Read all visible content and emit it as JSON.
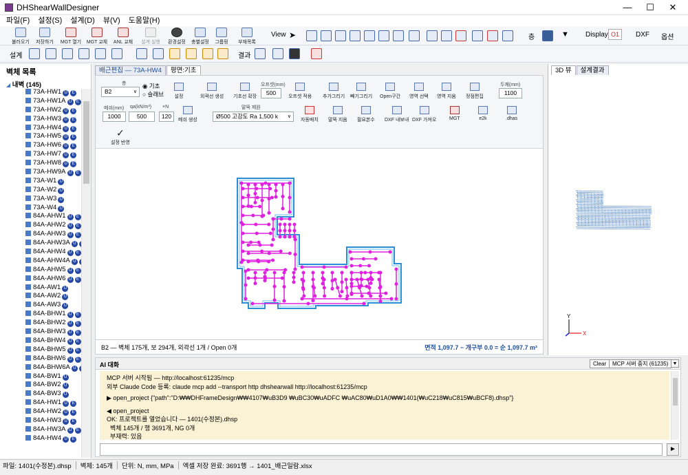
{
  "window": {
    "title": "DHShearWallDesigner",
    "minimize": "—",
    "maximize": "☐",
    "close": "✕"
  },
  "menu": [
    "파일(F)",
    "설정(S)",
    "설계(D)",
    "뷰(V)",
    "도움말(H)"
  ],
  "toolbar1": {
    "buttons": [
      "불러오기",
      "저장하기",
      "MGT 열기",
      "MGT 교체",
      "ANL 교체",
      "설계 실행",
      "환경설정",
      "충별설정",
      "그룹핑",
      "부재목록"
    ],
    "right_labels": {
      "view": "View",
      "layer": "층",
      "display": "Display",
      "display_value": "O1",
      "dxf": "DXF",
      "options": "옵션"
    }
  },
  "toolbar2": {
    "design": "설계",
    "result": "결과"
  },
  "left_panel": {
    "title": "벽체 목록",
    "root": "내벽 (145)",
    "items": [
      {
        "name": "73A-HW1",
        "badges": [
          "U",
          "E"
        ]
      },
      {
        "name": "73A-HW1A",
        "badges": [
          "U",
          "E"
        ]
      },
      {
        "name": "73A-HW2",
        "badges": [
          "U",
          "E"
        ]
      },
      {
        "name": "73A-HW3",
        "badges": [
          "U",
          "E"
        ]
      },
      {
        "name": "73A-HW4",
        "badges": [
          "U",
          "E"
        ]
      },
      {
        "name": "73A-HW5",
        "badges": [
          "U",
          "E"
        ]
      },
      {
        "name": "73A-HW6",
        "badges": [
          "U",
          "E"
        ]
      },
      {
        "name": "73A-HW7",
        "badges": [
          "U",
          "E"
        ]
      },
      {
        "name": "73A-HW8",
        "badges": [
          "U",
          "E"
        ]
      },
      {
        "name": "73A-HW9A",
        "badges": [
          "U",
          "E"
        ]
      },
      {
        "name": "73A-W1",
        "badges": [
          "U"
        ]
      },
      {
        "name": "73A-W2",
        "badges": [
          "U"
        ]
      },
      {
        "name": "73A-W3",
        "badges": [
          "U"
        ]
      },
      {
        "name": "73A-W4",
        "badges": [
          "U"
        ]
      },
      {
        "name": "84A-AHW1",
        "badges": [
          "U",
          "E"
        ]
      },
      {
        "name": "84A-AHW2",
        "badges": [
          "U",
          "E"
        ]
      },
      {
        "name": "84A-AHW3",
        "badges": [
          "U",
          "E"
        ]
      },
      {
        "name": "84A-AHW3A",
        "badges": [
          "U",
          "E"
        ]
      },
      {
        "name": "84A-AHW4",
        "badges": [
          "U",
          "E"
        ]
      },
      {
        "name": "84A-AHW4A",
        "badges": [
          "U",
          "E"
        ]
      },
      {
        "name": "84A-AHW5",
        "badges": [
          "U",
          "E"
        ]
      },
      {
        "name": "84A-AHW6",
        "badges": [
          "U",
          "E"
        ]
      },
      {
        "name": "84A-AW1",
        "badges": [
          "U"
        ]
      },
      {
        "name": "84A-AW2",
        "badges": [
          "U"
        ]
      },
      {
        "name": "84A-AW3",
        "badges": [
          "U"
        ]
      },
      {
        "name": "84A-BHW1",
        "badges": [
          "U",
          "E"
        ]
      },
      {
        "name": "84A-BHW2",
        "badges": [
          "U",
          "E"
        ]
      },
      {
        "name": "84A-BHW3",
        "badges": [
          "U",
          "E"
        ]
      },
      {
        "name": "84A-BHW4",
        "badges": [
          "U",
          "E"
        ]
      },
      {
        "name": "84A-BHW5",
        "badges": [
          "U",
          "E"
        ]
      },
      {
        "name": "84A-BHW6",
        "badges": [
          "U",
          "E"
        ]
      },
      {
        "name": "84A-BHW6A",
        "badges": [
          "U",
          "E"
        ]
      },
      {
        "name": "84A-BW1",
        "badges": [
          "U"
        ]
      },
      {
        "name": "84A-BW2",
        "badges": [
          "U"
        ]
      },
      {
        "name": "84A-BW3",
        "badges": [
          "U"
        ]
      },
      {
        "name": "84A-HW1",
        "badges": [
          "U",
          "E"
        ]
      },
      {
        "name": "84A-HW2",
        "badges": [
          "U",
          "E"
        ]
      },
      {
        "name": "84A-HW3",
        "badges": [
          "U",
          "E"
        ]
      },
      {
        "name": "84A-HW3A",
        "badges": [
          "U",
          "E"
        ]
      },
      {
        "name": "84A-HW4",
        "badges": [
          "U",
          "E"
        ]
      }
    ]
  },
  "tabs": {
    "tab1": "배근편집 — 73A-HW4",
    "tab2": "평면:기초"
  },
  "ribbon": {
    "floor_label": "층",
    "floor_value": "B2",
    "radio_foundation": "기초",
    "radio_slab": "슬래브",
    "settings": "설정",
    "outline_gen": "외곽선 생성",
    "baseline_ext": "기초선 확장",
    "offset_label": "오프셋(mm)",
    "offset_value": "500",
    "offset_apply": "오프셋 적용",
    "add_draw": "추가그리기",
    "sub_draw": "빼기그리기",
    "open_section": "Open구간",
    "select_region": "영역 선택",
    "delete_region": "영역 지움",
    "vertex_edit": "정점편집",
    "thickness_label": "두께(mm)",
    "thickness_value": "1100",
    "mesh_label": "메쉬(mm)",
    "mesh_value": "1000",
    "qa_label": "qa(kN/m²)",
    "qa_value": "500",
    "n_label": "×N",
    "n_value": "120",
    "mesh_gen": "메쉬 생성",
    "pile_spec_label": "말뚝 제원",
    "pile_spec_value": "Ø500 고강도 Ra 1,500 k",
    "auto_place": "자동배치",
    "pile_delete": "말뚝 지움",
    "required_count": "필요본수",
    "dxf_export": "DXF 내보내",
    "dxf_import": "DXF 가져오",
    "mgt": "MGT",
    "e2k": "e2k",
    "dhas": ".dhas",
    "apply_settings": "설정 반영"
  },
  "editor_status": {
    "left": "B2 — 벽체 175개, 보 294개, 외곽선 1개 / Open 0개",
    "right": "면적 1,097.7 − 개구부 0.0 = 순 1,097.7 m²"
  },
  "right_panel": {
    "tab1": "3D 뷰",
    "tab2": "설계결과",
    "axis_x": "X",
    "axis_y": "Y"
  },
  "ai": {
    "title": "AI 대화",
    "clear": "Clear",
    "mcp_stop": "MCP 서버 중지 (61235)",
    "log": [
      "MCP 서버 시작됨 — http://localhost:61235/mcp",
      "외부 Claude Code 등록: claude mcp add --transport http dhshearwall http://localhost:61235/mcp",
      "▶ open_project  {\"path\":\"D:₩₩DHFrameDesign₩₩4107₩uB3D9 ₩uBC30₩uADFC ₩uAC80₩uD1A0₩₩1401(₩uC218₩uC815₩uBCF8).dhsp\"}",
      "◀ open_project",
      "OK: 프로젝트를 열었습니다 — 1401(수정본).dhsp",
      "  벽체 145개 / 행 3691개, NG 0개",
      "  부재력: 있음"
    ],
    "send": "►"
  },
  "statusbar": {
    "file": "파일: 1401(수정본).dhsp",
    "walls": "벽체: 145개",
    "units": "단위: N, mm, MPa",
    "excel": "엑셀 저장 완료: 3691행 → 1401_배근일람.xlsx"
  },
  "colors": {
    "accent": "#1a4fa0",
    "wall": "#e020e0",
    "outline": "#2a8fd8",
    "badge": "#2447a3",
    "ai_bg": "#fbf2d6"
  }
}
